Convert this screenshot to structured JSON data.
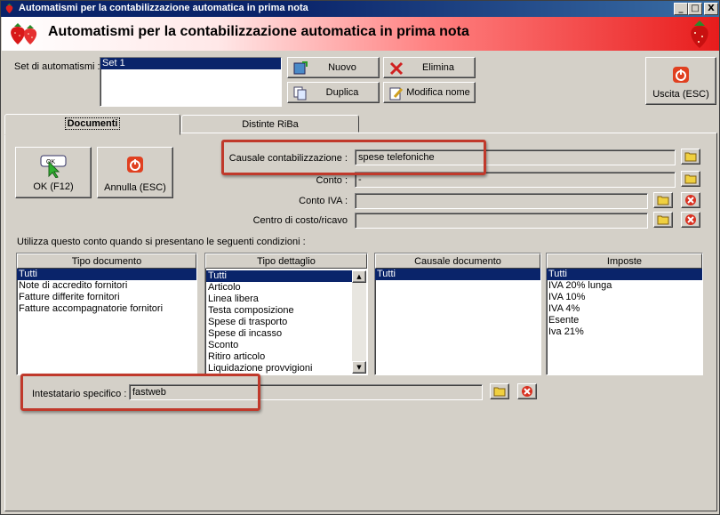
{
  "window": {
    "title": "Automatismi per la contabilizzazione automatica in prima nota",
    "min_label": "_",
    "max_label": "□",
    "close_label": "X"
  },
  "banner": {
    "title": "Automatismi per la contabilizzazione automatica in prima nota"
  },
  "set": {
    "label": "Set di automatismi :",
    "items": [
      "Set 1"
    ],
    "nuovo": "Nuovo",
    "elimina": "Elimina",
    "duplica": "Duplica",
    "modifica_nome": "Modifica nome",
    "uscita": "Uscita (ESC)"
  },
  "tabs": {
    "documenti": "Documenti",
    "distinte": "Distinte RiBa"
  },
  "form": {
    "ok": "OK (F12)",
    "ok_icon_text": "OK",
    "annulla": "Annulla (ESC)",
    "causale_label": "Causale contabilizzazione :",
    "causale_value": "spese telefoniche",
    "conto_label": "Conto :",
    "conto_value": "-",
    "conto_iva_label": "Conto IVA :",
    "conto_iva_value": "",
    "centro_label": "Centro di costo/ricavo",
    "centro_value": "",
    "conditions_label": "Utilizza questo conto quando si presentano le seguenti condizioni :",
    "intestatario_label": "Intestatario specifico :",
    "intestatario_value": "fastweb"
  },
  "lists": {
    "tipo_documento": {
      "header": "Tipo documento",
      "items": [
        "Tutti",
        "Note di accredito fornitori",
        "Fatture differite fornitori",
        "Fatture accompagnatorie fornitori"
      ]
    },
    "tipo_dettaglio": {
      "header": "Tipo dettaglio",
      "items": [
        "Tutti",
        "Articolo",
        "Linea libera",
        "Testa composizione",
        "Spese di trasporto",
        "Spese di incasso",
        "Sconto",
        "Ritiro articolo",
        "Liquidazione provvigioni"
      ]
    },
    "causale_documento": {
      "header": "Causale documento",
      "items": [
        "Tutti"
      ]
    },
    "imposte": {
      "header": "Imposte",
      "items": [
        "Tutti",
        "IVA 20% lunga",
        "IVA 10%",
        "IVA 4%",
        "Esente",
        "Iva 21%"
      ]
    }
  }
}
